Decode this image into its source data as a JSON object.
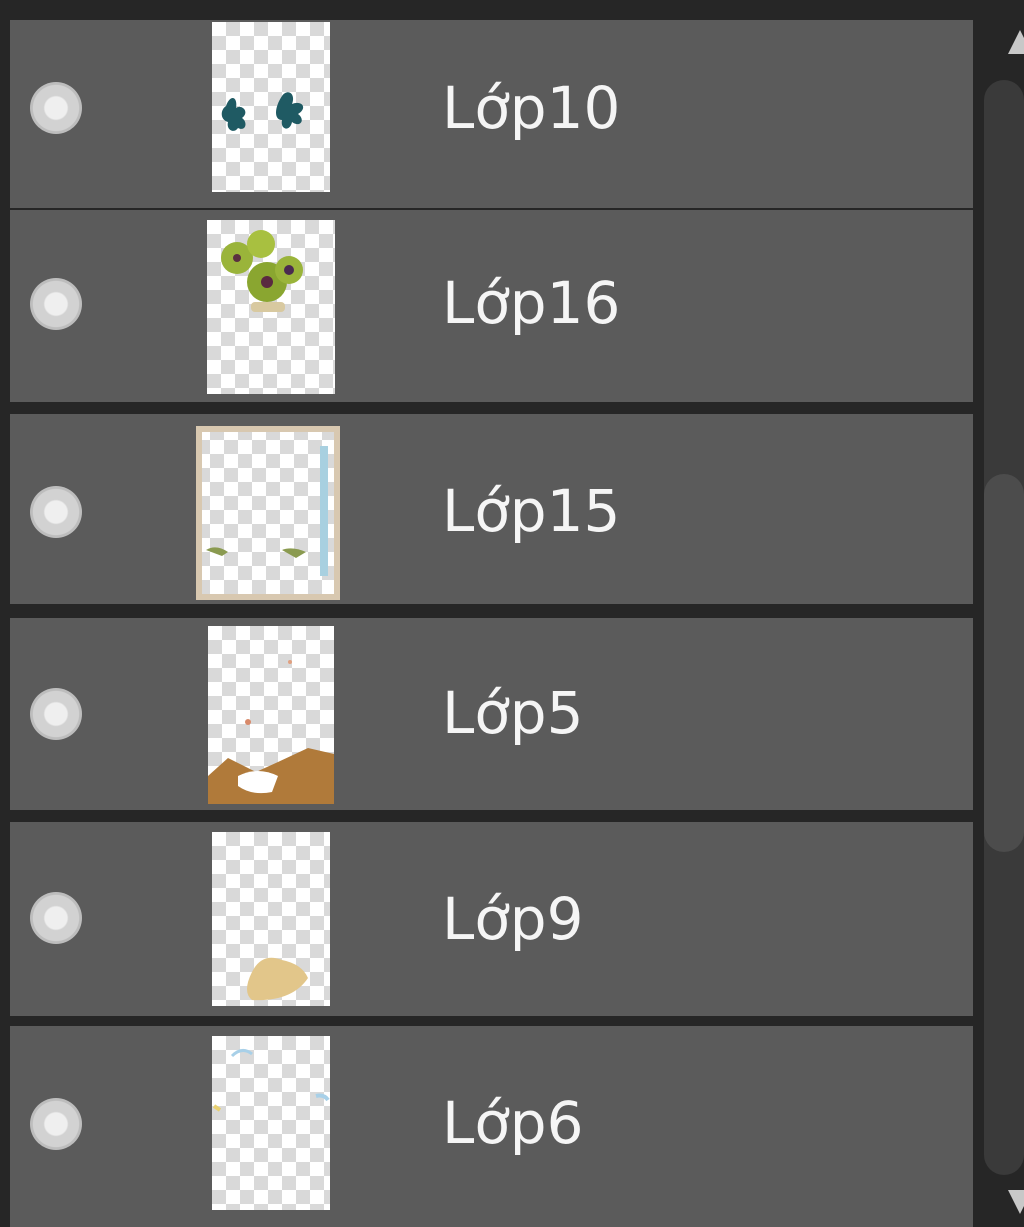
{
  "layers": [
    {
      "name": "Lớp10",
      "thumbnail_icon": "teal-leaves-thumbnail",
      "visible_toggle": "eye-dot-icon"
    },
    {
      "name": "Lớp16",
      "thumbnail_icon": "green-flower-thumbnail",
      "visible_toggle": "eye-dot-icon"
    },
    {
      "name": "Lớp15",
      "thumbnail_icon": "frame-border-thumbnail",
      "visible_toggle": "eye-dot-icon"
    },
    {
      "name": "Lớp5",
      "thumbnail_icon": "brown-ground-thumbnail",
      "visible_toggle": "eye-dot-icon"
    },
    {
      "name": "Lớp9",
      "thumbnail_icon": "beige-shape-thumbnail",
      "visible_toggle": "eye-dot-icon"
    },
    {
      "name": "Lớp6",
      "thumbnail_icon": "light-blue-sketch-thumbnail",
      "visible_toggle": "eye-dot-icon"
    }
  ],
  "colors": {
    "panel_background": "#262626",
    "row_background": "#5b5b5b",
    "text": "#f5f5f5"
  }
}
